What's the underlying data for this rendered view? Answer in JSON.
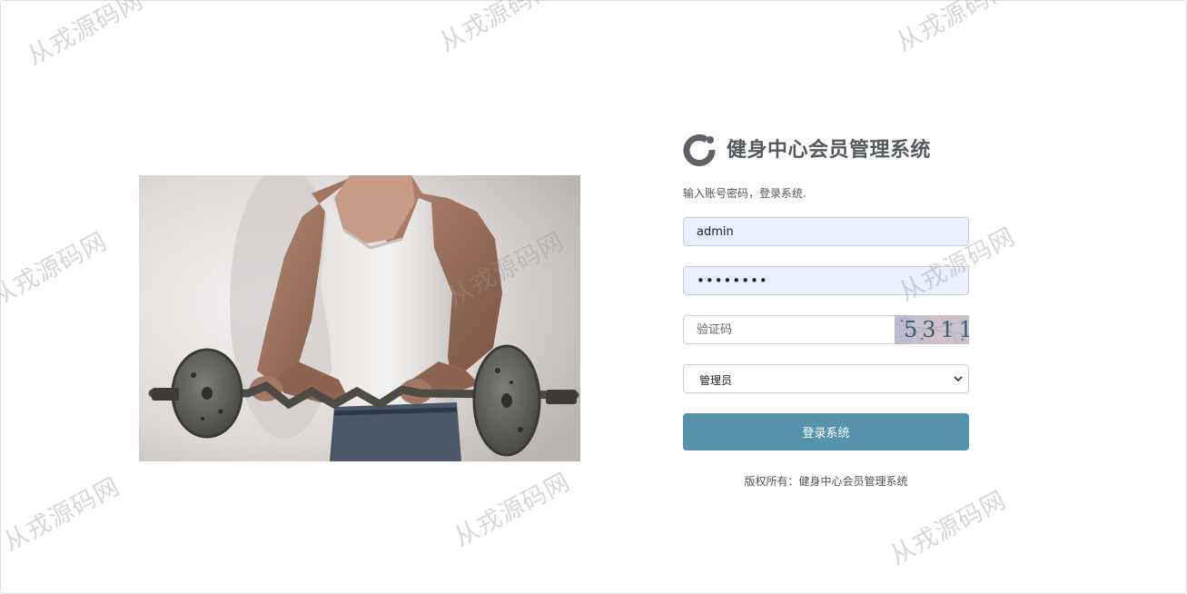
{
  "watermark": {
    "text": "从戎源码网"
  },
  "brand": {
    "title": "健身中心会员管理系统",
    "logo_icon": "ring-logo-icon",
    "logo_color": "#5f6368"
  },
  "login": {
    "subtitle": "输入账号密码，登录系统.",
    "username_value": "admin",
    "password_value": "••••••••",
    "captcha_placeholder": "验证码",
    "captcha_code": "5311",
    "role_selected": "管理员",
    "submit_label": "登录系统",
    "submit_color": "#5592ab",
    "autofill_color": "#e8f0fe"
  },
  "photo": {
    "subject": "fitness-man-barbell"
  },
  "footer": {
    "copyright": "版权所有：健身中心会员管理系统"
  }
}
